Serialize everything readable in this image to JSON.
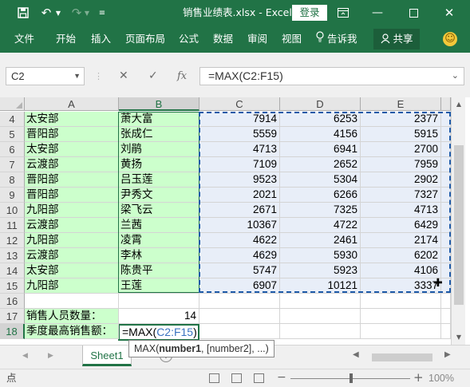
{
  "window": {
    "title": "销售业绩表.xlsx - Excel",
    "login_label": "登录"
  },
  "ribbon": {
    "tabs": [
      "文件",
      "开始",
      "插入",
      "页面布局",
      "公式",
      "数据",
      "审阅",
      "视图"
    ],
    "tell_me": "告诉我",
    "share": "共享"
  },
  "formula_bar": {
    "name_box": "C2",
    "cancel_icon": "✕",
    "enter_icon": "✓",
    "fx": "fx",
    "formula": "=MAX(C2:F15)"
  },
  "grid": {
    "columns": [
      "A",
      "B",
      "C",
      "D",
      "E"
    ],
    "active_column": "B",
    "rows": [
      {
        "num": "4",
        "a": "太安部",
        "b": "萧大富",
        "c": "7914",
        "d": "6253",
        "e": "2377"
      },
      {
        "num": "5",
        "a": "晋阳部",
        "b": "张成仁",
        "c": "5559",
        "d": "4156",
        "e": "5915"
      },
      {
        "num": "6",
        "a": "太安部",
        "b": "刘鹃",
        "c": "4713",
        "d": "6941",
        "e": "2700"
      },
      {
        "num": "7",
        "a": "云渡部",
        "b": "黄扬",
        "c": "7109",
        "d": "2652",
        "e": "7959"
      },
      {
        "num": "8",
        "a": "晋阳部",
        "b": "吕玉莲",
        "c": "9523",
        "d": "5304",
        "e": "2902"
      },
      {
        "num": "9",
        "a": "晋阳部",
        "b": "尹秀文",
        "c": "2021",
        "d": "6266",
        "e": "7327"
      },
      {
        "num": "10",
        "a": "九阳部",
        "b": "梁飞云",
        "c": "2671",
        "d": "7325",
        "e": "4713"
      },
      {
        "num": "11",
        "a": "云渡部",
        "b": "兰茜",
        "c": "10367",
        "d": "4722",
        "e": "6429"
      },
      {
        "num": "12",
        "a": "九阳部",
        "b": "凌霄",
        "c": "4622",
        "d": "2461",
        "e": "2174"
      },
      {
        "num": "13",
        "a": "云渡部",
        "b": "李林",
        "c": "4629",
        "d": "5930",
        "e": "6202"
      },
      {
        "num": "14",
        "a": "太安部",
        "b": "陈贵平",
        "c": "5747",
        "d": "5923",
        "e": "4106"
      },
      {
        "num": "15",
        "a": "九阳部",
        "b": "王莲",
        "c": "6907",
        "d": "10121",
        "e": "3337"
      },
      {
        "num": "16",
        "a": "",
        "b": "",
        "c": "",
        "d": "",
        "e": ""
      },
      {
        "num": "17",
        "a": "销售人员数量：",
        "b": "14",
        "c": "",
        "d": "",
        "e": ""
      },
      {
        "num": "18",
        "a": "季度最高销售额：",
        "b": "",
        "c": "",
        "d": "",
        "e": ""
      }
    ],
    "active_row": "18",
    "edit_cell": {
      "prefix": "=MAX(",
      "ref": "C2:F15",
      "suffix": ")"
    }
  },
  "tooltip": {
    "fn": "MAX(",
    "arg1": "number1",
    "rest": ", [number2], ...)"
  },
  "sheets": {
    "tabs": [
      "Sheet1"
    ],
    "add_label": "+"
  },
  "status": {
    "mode": "点",
    "zoom": "100%"
  },
  "colors": {
    "excel_green": "#217346",
    "range_fill": "#e8eef8",
    "label_fill": "#ccffcc",
    "ref_blue": "#3b73c0"
  }
}
